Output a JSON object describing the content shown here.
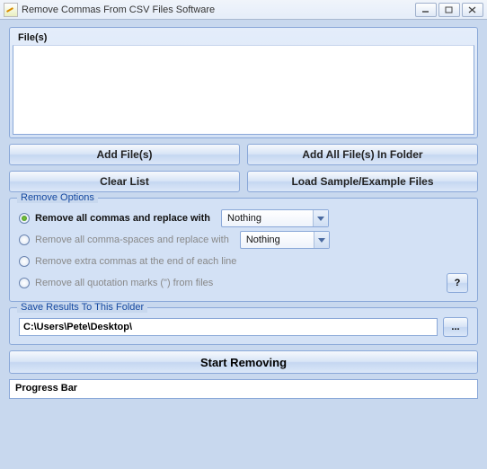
{
  "window": {
    "title": "Remove Commas From CSV Files Software"
  },
  "files": {
    "header": "File(s)"
  },
  "buttons": {
    "add_files": "Add File(s)",
    "add_folder": "Add All File(s) In Folder",
    "clear_list": "Clear List",
    "load_sample": "Load Sample/Example Files",
    "start": "Start Removing",
    "browse": "...",
    "help": "?"
  },
  "groups": {
    "remove_options": "Remove Options",
    "save_results": "Save Results To This Folder"
  },
  "options": {
    "opt1": "Remove all commas and replace with",
    "opt2": "Remove all comma-spaces and replace with",
    "opt3": "Remove extra commas at the end of each line",
    "opt4": "Remove all quotation marks (\") from files",
    "combo1_value": "Nothing",
    "combo2_value": "Nothing"
  },
  "save": {
    "path": "C:\\Users\\Pete\\Desktop\\"
  },
  "progress": {
    "label": "Progress Bar"
  }
}
